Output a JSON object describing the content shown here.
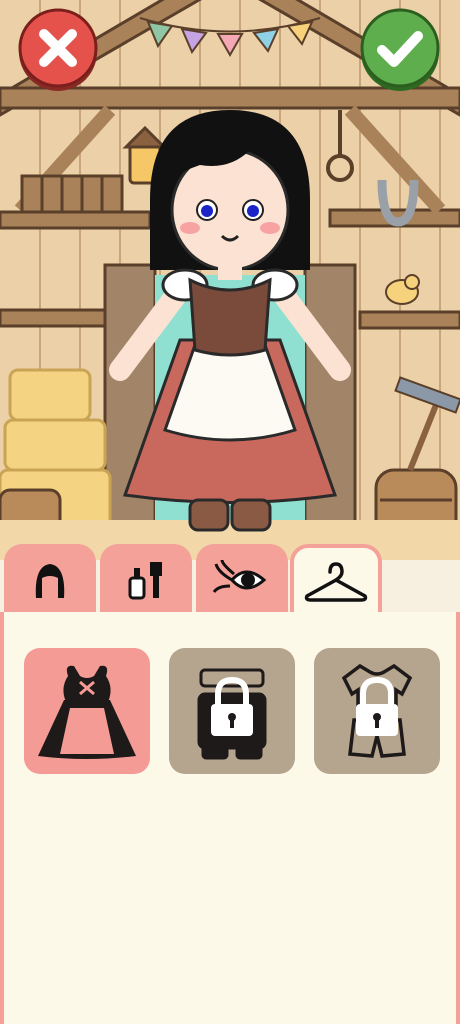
{
  "screen": "dress-up-wardrobe",
  "colors": {
    "accent_pink": "#f4a19a",
    "panel_cream": "#fdf9e9",
    "locked_card": "#b5a48e",
    "cancel_red": "#e4524b",
    "confirm_green": "#5fae4e"
  },
  "top_buttons": {
    "cancel": {
      "icon": "close-icon"
    },
    "confirm": {
      "icon": "checkmark-icon"
    }
  },
  "tabs": [
    {
      "id": "hair",
      "icon": "hair-icon",
      "active": false
    },
    {
      "id": "makeup",
      "icon": "makeup-brush-icon",
      "active": false
    },
    {
      "id": "eyes",
      "icon": "eye-lashes-icon",
      "active": false
    },
    {
      "id": "clothes",
      "icon": "hanger-icon",
      "active": true
    }
  ],
  "outfits": [
    {
      "id": "peasant-dress",
      "icon": "dress-icon",
      "locked": false,
      "selected": true
    },
    {
      "id": "overalls",
      "icon": "overalls-icon",
      "locked": true,
      "selected": false
    },
    {
      "id": "shirt-shorts",
      "icon": "shirt-shorts-icon",
      "locked": true,
      "selected": false
    }
  ]
}
